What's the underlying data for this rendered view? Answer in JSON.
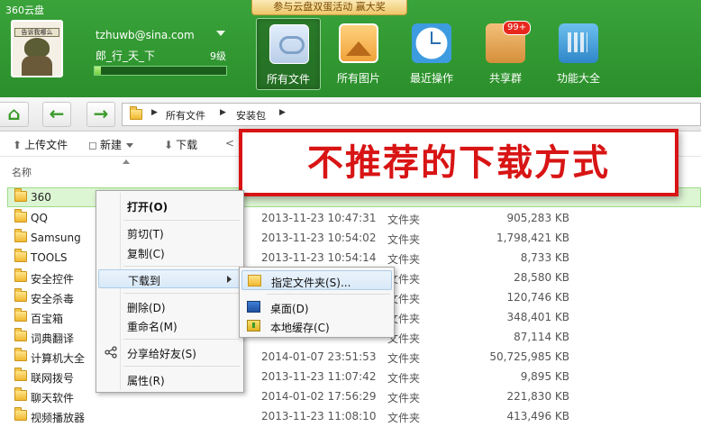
{
  "header": {
    "app_title": "360云盘",
    "promo_banner": "参与云盘双蛋活动 赢大奖",
    "avatar_caption": "告诉我哪么",
    "user_email": "tzhuwb@sina.com",
    "nickname": "郎_行_天_下",
    "level": "9级",
    "level_progress": 0.05,
    "nav": [
      {
        "label": "所有文件",
        "icon": "files-cloud-icon",
        "active": true
      },
      {
        "label": "所有图片",
        "icon": "photos-icon",
        "active": false
      },
      {
        "label": "最近操作",
        "icon": "clock-icon",
        "active": false
      },
      {
        "label": "共享群",
        "icon": "share-group-icon",
        "active": false,
        "badge": "99+"
      },
      {
        "label": "功能大全",
        "icon": "tools-icon",
        "active": false
      }
    ]
  },
  "addressbar": {
    "home_glyph": "⌂",
    "back_glyph": "←",
    "forward_glyph": "→",
    "path": [
      "所有文件",
      "安装包"
    ]
  },
  "toolbar": {
    "upload_label": "上传文件",
    "new_label": "新建",
    "download_label": "下载"
  },
  "list_header": {
    "name_col": "名称"
  },
  "annotation": "不推荐的下载方式",
  "files": [
    {
      "name": "360",
      "date": "",
      "type": "",
      "size": "",
      "selected": true
    },
    {
      "name": "QQ",
      "date": "2013-11-23 10:47:31",
      "type": "文件夹",
      "size": "905,283 KB"
    },
    {
      "name": "Samsung",
      "date": "2013-11-23 10:54:02",
      "type": "文件夹",
      "size": "1,798,421 KB"
    },
    {
      "name": "TOOLS",
      "date": "2013-11-23 10:54:14",
      "type": "文件夹",
      "size": "8,733 KB"
    },
    {
      "name": "安全控件",
      "date": "",
      "type": "文件夹",
      "size": "28,580 KB"
    },
    {
      "name": "安全杀毒",
      "date": "",
      "type": "文件夹",
      "size": "120,746 KB"
    },
    {
      "name": "百宝箱",
      "date": "",
      "type": "文件夹",
      "size": "348,401 KB"
    },
    {
      "name": "词典翻译",
      "date": "",
      "type": "文件夹",
      "size": "87,114 KB"
    },
    {
      "name": "计算机大全",
      "date": "2014-01-07 23:51:53",
      "type": "文件夹",
      "size": "50,725,985 KB"
    },
    {
      "name": "联网拨号",
      "date": "2013-11-23 11:07:42",
      "type": "文件夹",
      "size": "9,895 KB"
    },
    {
      "name": "聊天软件",
      "date": "2014-01-02 17:56:29",
      "type": "文件夹",
      "size": "221,830 KB"
    },
    {
      "name": "视频播放器",
      "date": "2013-11-23 11:08:10",
      "type": "文件夹",
      "size": "413,496 KB"
    }
  ],
  "context_menu": {
    "open": "打开(O)",
    "cut": "剪切(T)",
    "copy": "复制(C)",
    "download_to": "下载到",
    "delete": "删除(D)",
    "rename": "重命名(M)",
    "share": "分享给好友(S)",
    "properties": "属性(R)"
  },
  "submenu": {
    "folder": "指定文件夹(S)...",
    "desktop": "桌面(D)",
    "local_cache": "本地缓存(C)"
  },
  "colors": {
    "header_green": "#2b8f2b",
    "annotation_red": "#d81414",
    "selected_row": "#dcf5d2"
  }
}
